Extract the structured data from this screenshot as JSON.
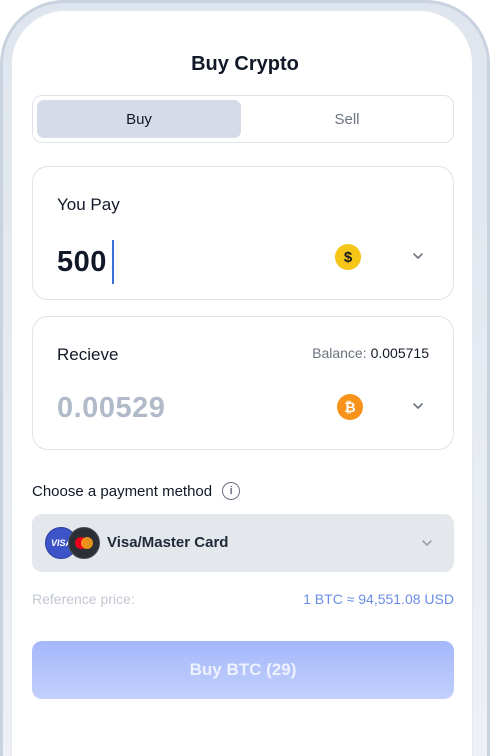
{
  "header": {
    "title": "Buy Crypto"
  },
  "tabs": [
    {
      "label": "Buy",
      "active": true
    },
    {
      "label": "Sell",
      "active": false
    }
  ],
  "pay": {
    "label": "You Pay",
    "amount": "500",
    "coin_symbol": "$",
    "coin_icon": "dollar-coin-icon",
    "coin_color": "#f5c518"
  },
  "receive": {
    "label": "Recieve",
    "balance_label": "Balance:",
    "balance_value": "0.005715",
    "amount": "0.00529",
    "coin_symbol": "₿",
    "coin_icon": "bitcoin-coin-icon",
    "coin_color": "#f7931a"
  },
  "payment": {
    "label": "Choose a payment method",
    "info_symbol": "i",
    "method": "Visa/Master Card",
    "visa_text": "VISA"
  },
  "reference": {
    "label": "Reference price:",
    "value": "1 BTC ≈ 94,551.08 USD"
  },
  "action": {
    "buy_label": "Buy BTC (29)"
  },
  "colors": {
    "accent": "#6a8de8",
    "button_gradient_start": "#a4b7fb",
    "button_gradient_end": "#c3d0fb",
    "active_tab": "#d5dce7"
  }
}
